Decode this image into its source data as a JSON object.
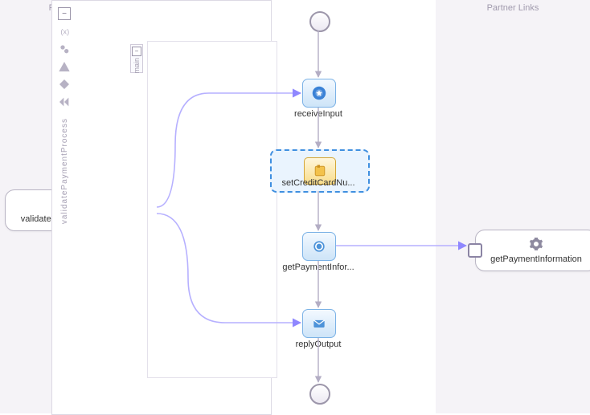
{
  "columns": {
    "left_title": "Partner Links",
    "right_title": "Partner Links"
  },
  "partners": {
    "left": {
      "label": "validatepaymentprocess_client"
    },
    "right": {
      "label": "getPaymentInformation"
    }
  },
  "scope": {
    "name": "validatePaymentProcess",
    "sequence_name": "main"
  },
  "nodes": {
    "start": {
      "label": ""
    },
    "receiveInput": {
      "label": "receiveInput"
    },
    "setCreditCardNumber": {
      "label": "setCreditCardNu...",
      "selected": true
    },
    "getPaymentInformation": {
      "label": "getPaymentInfor..."
    },
    "replyOutput": {
      "label": "replyOutput"
    },
    "end": {
      "label": ""
    }
  },
  "icons": {
    "gear": "gear-icon",
    "collapse": "collapse-icon",
    "variables": "variables-icon",
    "correlation": "correlation-icon",
    "fault": "fault-handler-icon",
    "event": "event-handler-icon",
    "compensation": "compensation-icon",
    "assign": "assign-icon",
    "invoke": "invoke-icon",
    "receive": "receive-icon",
    "reply": "reply-icon"
  },
  "colors": {
    "selected": "#3f8fe0",
    "association": "#b6b0ff",
    "flow": "#b3adc4"
  }
}
